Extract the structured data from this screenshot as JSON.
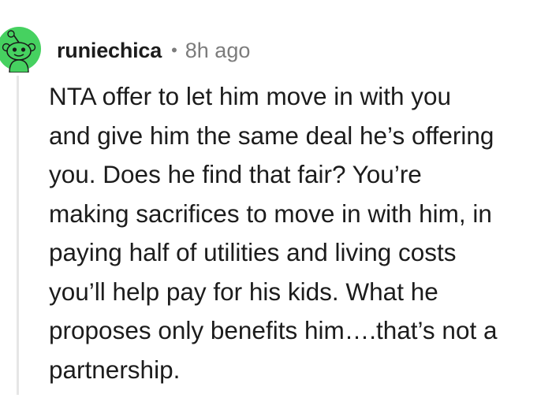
{
  "comment": {
    "username": "runiechica",
    "separator": "•",
    "timestamp": "8h ago",
    "avatar_color": "#46d160",
    "body_lines": [
      "NTA offer to let him move in with you",
      "and give him the same deal he’s offering",
      "you. Does he find that fair? You’re",
      "making sacrifices to move in with him, in",
      "paying half of utilities and living costs",
      "you’ll help pay for his kids. What he",
      "proposes only benefits him….that’s not a",
      "partnership."
    ]
  }
}
